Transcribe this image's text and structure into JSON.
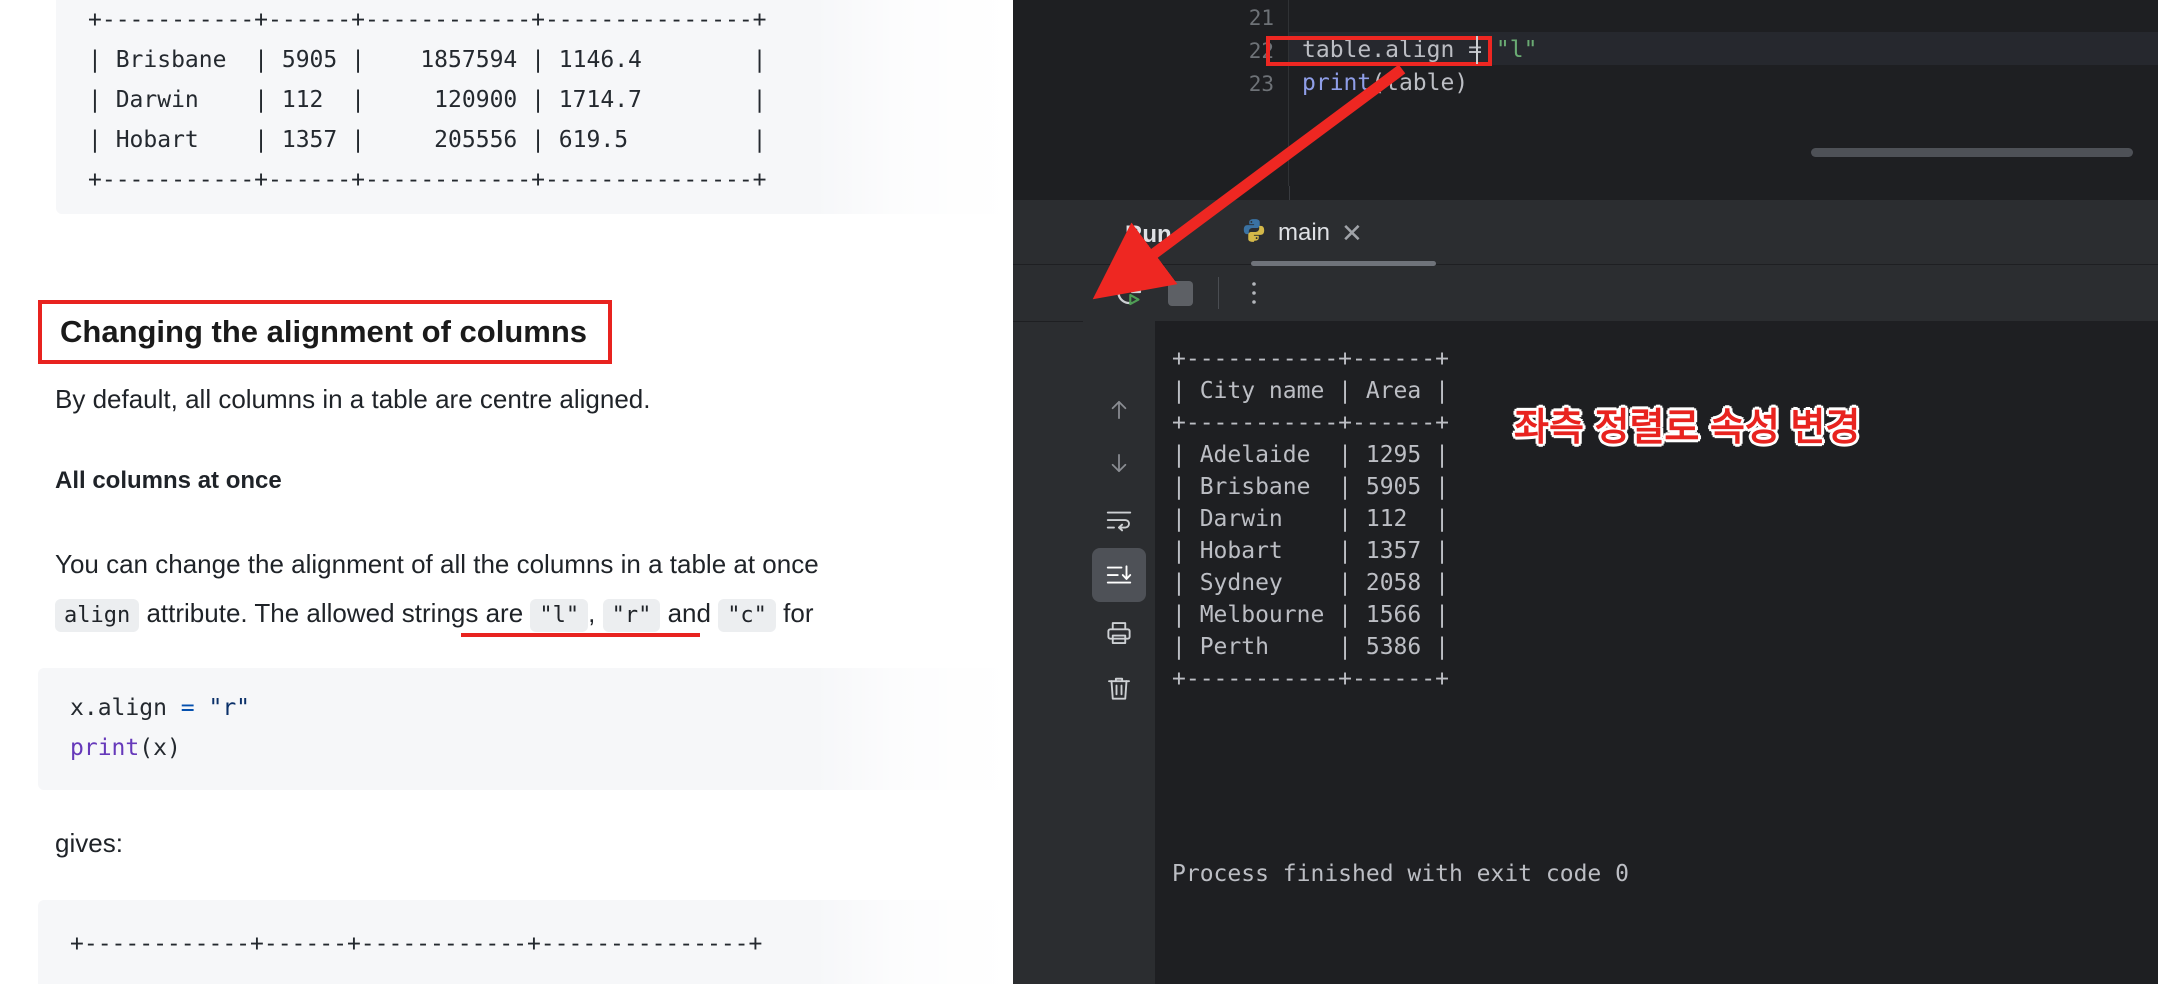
{
  "doc": {
    "top_table_lines": [
      "+-----------+------+------------+---------------+",
      "| Brisbane  | 5905 |    1857594 | 1146.4        |",
      "| Darwin    | 112  |     120900 | 1714.7        |",
      "| Hobart    | 1357 |     205556 | 619.5         |",
      "+-----------+------+------------+---------------+"
    ],
    "heading": "Changing the alignment of columns",
    "paragraph1": "By default, all columns in a table are centre aligned.",
    "subheading": "All columns at once",
    "paragraph2_part1": "You can change the alignment of all the columns in a table at once",
    "paragraph2_code1": "align",
    "paragraph2_part2": " attribute. The allowed strings are ",
    "paragraph2_code2": "\"l\"",
    "paragraph2_sep1": ", ",
    "paragraph2_code3": "\"r\"",
    "paragraph2_sep2": " and ",
    "paragraph2_code4": "\"c\"",
    "paragraph2_part3": " for",
    "code_block_1": "x.align = \"r\"",
    "code_block_1_var": "x.align ",
    "code_block_1_op": "= ",
    "code_block_1_str": "\"r\"",
    "code_block_2_fn": "print",
    "code_block_2_args": "(x)",
    "gives_label": "gives:",
    "bottom_table_line": "+------------+------+------------+---------------+"
  },
  "ide": {
    "editor": {
      "lines": [
        {
          "number": "21",
          "text": ""
        },
        {
          "number": "22",
          "text": "table.align = \"l\""
        },
        {
          "number": "23",
          "text": "print(table)"
        }
      ],
      "line22_var": "table.align ",
      "line22_op": "= ",
      "line22_str": "\"l\"",
      "line23_fn": "print",
      "line23_args": "(table)"
    },
    "run_panel": {
      "title": "Run",
      "tab_label": "main",
      "tab_icon": "python-icon",
      "close_icon": "close-icon",
      "toolbar": {
        "rerun": "rerun-icon",
        "stop": "stop-icon",
        "more": "more-options-icon"
      },
      "gutter_icons": [
        "arrow-up-icon",
        "arrow-down-icon",
        "soft-wrap-icon",
        "scroll-to-end-icon",
        "print-icon",
        "trash-icon"
      ]
    },
    "console": {
      "lines": [
        "+-----------+------+",
        "| City name | Area |",
        "+-----------+------+",
        "| Adelaide  | 1295 |",
        "| Brisbane  | 5905 |",
        "| Darwin    | 112  |",
        "| Hobart    | 1357 |",
        "| Sydney    | 2058 |",
        "| Melbourne | 1566 |",
        "| Perth     | 5386 |",
        "+-----------+------+"
      ],
      "process_finished": "Process finished with exit code 0"
    },
    "rail_icons": [
      "python-console-icon",
      "run-icon",
      "services-stack-icon",
      "services-icon",
      "terminal-icon",
      "problems-icon",
      "git-branch-icon"
    ]
  },
  "annotations": {
    "korean_note": "좌측 정렬로 속성 변경",
    "accent_red": "#e8231f"
  }
}
